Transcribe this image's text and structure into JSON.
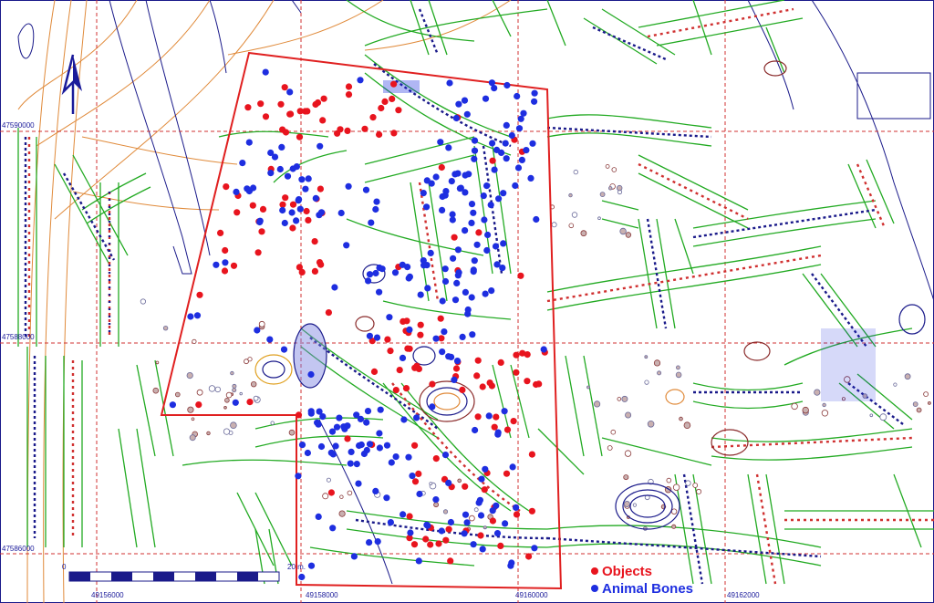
{
  "map": {
    "grid_labels": {
      "northings": [
        "47590000",
        "47588000",
        "47586000"
      ],
      "eastings": [
        "49156000",
        "49158000",
        "49160000",
        "49162000"
      ]
    },
    "scale_bar": {
      "start_label": "0",
      "end_label": "20 m."
    },
    "legend": {
      "items": [
        {
          "label": "Objects",
          "color": "#e8141e"
        },
        {
          "label": "Animal Bones",
          "color": "#1e2ee0"
        }
      ]
    },
    "colors": {
      "excavation_outline": "#e02020",
      "grid": "#d03030",
      "feature_green": "#22aa22",
      "contour_orange": "#e08a3a",
      "trench_navy": "#1a1a8a",
      "north_arrow": "#1a1a9a"
    },
    "north_arrow_icon": "north-arrow-icon"
  }
}
